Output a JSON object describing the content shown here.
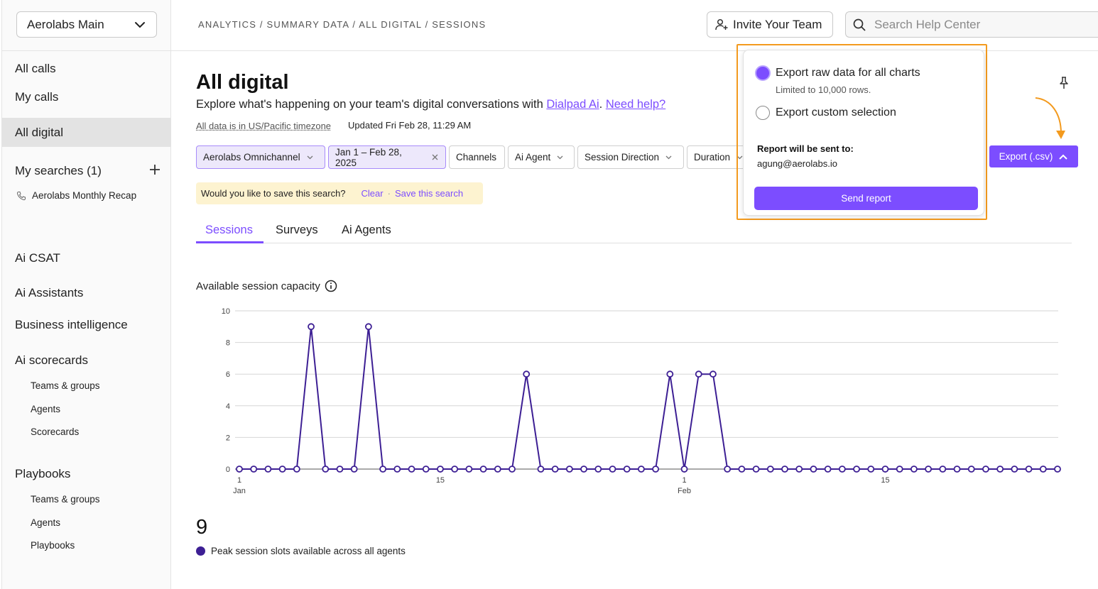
{
  "sidebar": {
    "workspace": "Aerolabs Main",
    "items": [
      {
        "label": "All calls"
      },
      {
        "label": "My calls"
      },
      {
        "label": "All digital"
      },
      {
        "label": "My searches (1)"
      },
      {
        "label": "Ai CSAT"
      },
      {
        "label": "Ai Assistants"
      },
      {
        "label": "Business intelligence"
      },
      {
        "label": "Ai scorecards"
      },
      {
        "label": "Playbooks"
      }
    ],
    "saved_search": "Aerolabs Monthly Recap",
    "scorecards_sub": [
      "Teams & groups",
      "Agents",
      "Scorecards"
    ],
    "playbooks_sub": [
      "Teams & groups",
      "Agents",
      "Playbooks"
    ]
  },
  "topbar": {
    "breadcrumb": "ANALYTICS / SUMMARY DATA / ALL DIGITAL / SESSIONS",
    "invite_label": "Invite Your Team",
    "search_placeholder": "Search Help Center"
  },
  "page": {
    "title": "All digital",
    "subtitle_prefix": "Explore what's happening on your team's digital conversations with ",
    "subtitle_link": "Dialpad Ai",
    "subtitle_sep": ". ",
    "help_link": "Need help?",
    "timezone": "All data is in US/Pacific timezone",
    "updated": "Updated Fri Feb 28, 11:29 AM"
  },
  "filters": [
    {
      "label": "Aerolabs Omnichannel",
      "selected": true,
      "icon": "chevron-down"
    },
    {
      "label": "Jan 1 – Feb 28, 2025",
      "selected": true,
      "icon": "close"
    },
    {
      "label": "Channels",
      "selected": false,
      "icon": ""
    },
    {
      "label": "Ai Agent",
      "selected": false,
      "icon": "chevron-down"
    },
    {
      "label": "Session Direction",
      "selected": false,
      "icon": "chevron-down"
    },
    {
      "label": "Duration",
      "selected": false,
      "icon": "chevron-down"
    }
  ],
  "save_banner": {
    "question": "Would you like to save this search?",
    "clear": "Clear",
    "dot": "·",
    "save": "Save this search"
  },
  "tabs": [
    {
      "label": "Sessions",
      "active": true
    },
    {
      "label": "Surveys",
      "active": false
    },
    {
      "label": "Ai Agents",
      "active": false
    }
  ],
  "export": {
    "button_label": "Export (.csv)",
    "option_all": "Export raw data for all charts",
    "option_all_note": "Limited to 10,000 rows.",
    "option_custom": "Export custom selection",
    "sent_to_label": "Report will be sent to:",
    "email": "agung@aerolabs.io",
    "send_label": "Send report"
  },
  "summary": {
    "value": "9",
    "legend": "Peak session slots available across all agents"
  },
  "colors": {
    "accent": "#7c4dff",
    "series": "#3d1f94",
    "highlight": "#f39a1e"
  },
  "chart_data": {
    "type": "line",
    "title": "Available session capacity",
    "ylim": [
      0,
      10
    ],
    "yticks": [
      0,
      2,
      4,
      6,
      8,
      10
    ],
    "xticks": [
      {
        "day": 1,
        "label": "1",
        "sublabel": "Jan"
      },
      {
        "day": 15,
        "label": "15",
        "sublabel": ""
      },
      {
        "day": 32,
        "label": "1",
        "sublabel": "Feb"
      },
      {
        "day": 46,
        "label": "15",
        "sublabel": ""
      }
    ],
    "grid": true,
    "series": [
      {
        "name": "Peak session slots available across all agents",
        "values": [
          0,
          0,
          0,
          0,
          0,
          9,
          0,
          0,
          0,
          9,
          0,
          0,
          0,
          0,
          0,
          0,
          0,
          0,
          0,
          0,
          6,
          0,
          0,
          0,
          0,
          0,
          0,
          0,
          0,
          0,
          6,
          0,
          6,
          6,
          0,
          0,
          0,
          0,
          0,
          0,
          0,
          0,
          0,
          0,
          0,
          0,
          0,
          0,
          0,
          0,
          0,
          0,
          0,
          0,
          0,
          0,
          0,
          0
        ]
      }
    ]
  }
}
